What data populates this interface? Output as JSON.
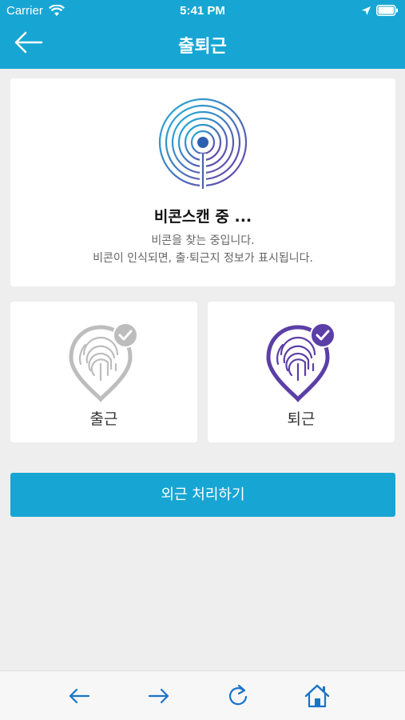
{
  "status_bar": {
    "carrier": "Carrier",
    "time": "5:41 PM"
  },
  "nav": {
    "title": "출퇴근",
    "back_icon": "back-arrow-icon"
  },
  "beacon": {
    "title": "비콘스캔 중 ...",
    "desc_line1": "비콘을 찾는 중입니다.",
    "desc_line2": "비콘이 인식되면, 출·퇴근지 정보가 표시됩니다."
  },
  "check": {
    "in_label": "출근",
    "out_label": "퇴근",
    "in_color": "#bdbdbd",
    "out_color": "#5b3fa6"
  },
  "outside_button": {
    "label": "외근 처리하기"
  },
  "toolbar": {
    "back_icon": "back-icon",
    "forward_icon": "forward-icon",
    "refresh_icon": "refresh-icon",
    "home_icon": "home-icon"
  },
  "colors": {
    "accent": "#17a6d3",
    "toolbar_icon": "#1a73c9"
  }
}
